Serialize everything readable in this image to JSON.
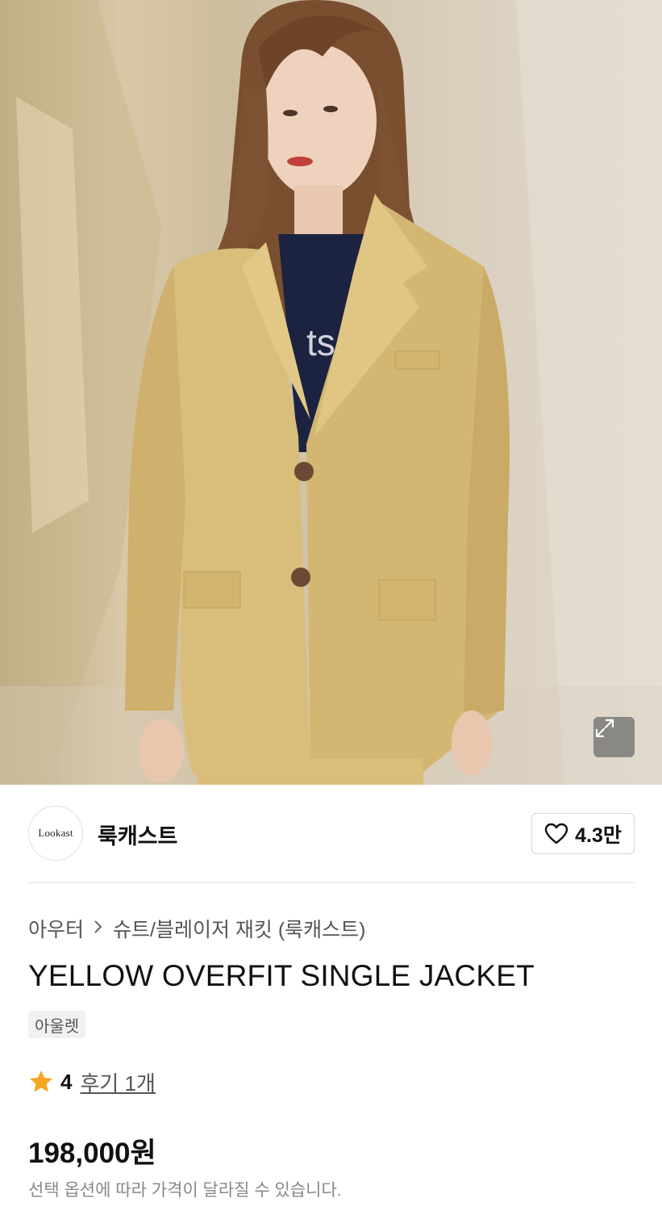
{
  "hero": {
    "image_alt": "Model wearing yellow overfit single jacket",
    "expand_icon": "expand-icon"
  },
  "brand": {
    "logo_text": "Lookast",
    "name": "룩캐스트"
  },
  "like": {
    "icon": "heart-icon",
    "count": "4.3만"
  },
  "breadcrumb": {
    "items": [
      "아우터",
      "슈트/블레이저 재킷 (룩캐스트)"
    ],
    "separator_icon": "chevron-right-icon"
  },
  "product": {
    "title": "YELLOW OVERFIT SINGLE JACKET",
    "tag": "아울렛"
  },
  "rating": {
    "icon": "star-icon",
    "score": "4",
    "review_label": "후기 1개"
  },
  "price": {
    "value": "198,000원",
    "note": "선택 옵션에 따라 가격이 달라질 수 있습니다."
  },
  "colors": {
    "jacket": "#d9bd7a",
    "star": "#f5a623",
    "text": "#111111",
    "muted": "#888888"
  }
}
